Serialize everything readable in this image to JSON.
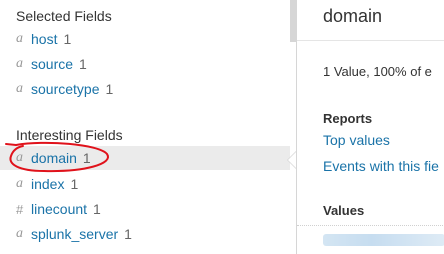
{
  "selected_fields": {
    "heading": "Selected Fields",
    "items": [
      {
        "type": "a",
        "name": "host",
        "count": "1"
      },
      {
        "type": "a",
        "name": "source",
        "count": "1"
      },
      {
        "type": "a",
        "name": "sourcetype",
        "count": "1"
      }
    ]
  },
  "interesting_fields": {
    "heading": "Interesting Fields",
    "items": [
      {
        "type": "a",
        "name": "domain",
        "count": "1",
        "selected": true
      },
      {
        "type": "a",
        "name": "index",
        "count": "1"
      },
      {
        "type": "#",
        "name": "linecount",
        "count": "1"
      },
      {
        "type": "a",
        "name": "splunk_server",
        "count": "1"
      }
    ]
  },
  "detail_panel": {
    "title": "domain",
    "summary": "1 Value, 100% of e",
    "reports_heading": "Reports",
    "links": [
      "Top values",
      "Events with this fie"
    ],
    "values_heading": "Values"
  },
  "annotation": {
    "color": "#e0121b"
  }
}
